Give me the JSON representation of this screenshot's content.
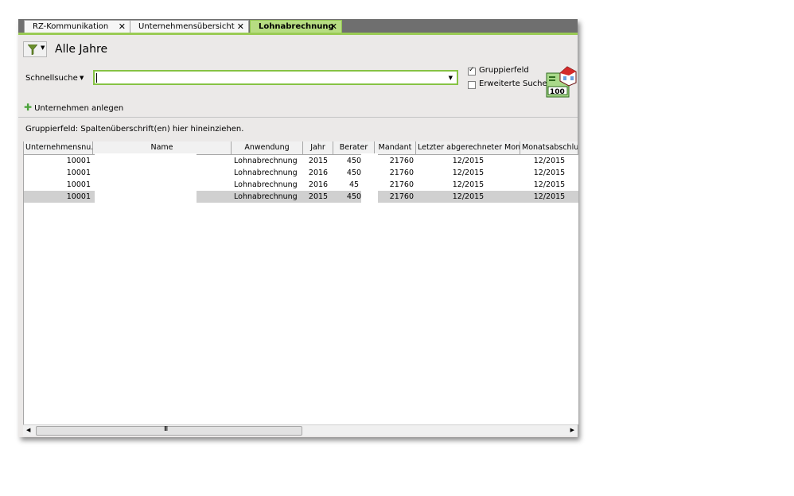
{
  "tabs": [
    {
      "label": "RZ-Kommunikation",
      "active": false
    },
    {
      "label": "Unternehmensübersicht",
      "active": false
    },
    {
      "label": "Lohnabrechnung",
      "active": true
    }
  ],
  "tab_close_glyph": "✕",
  "colors": {
    "accent": "#9acb55",
    "tab_active": "#b7dd82",
    "input_border": "#86c244",
    "selected_row": "#d0d0d0"
  },
  "header": {
    "view_title": "Alle Jahre",
    "filter_icon": "funnel-icon"
  },
  "search": {
    "label": "Schnellsuche",
    "value": ""
  },
  "options": {
    "gruppierfeld": {
      "label": "Gruppierfeld",
      "checked": true
    },
    "erweiterte_suche": {
      "label": "Erweiterte Suche",
      "checked": false
    }
  },
  "actions": {
    "add_company": "Unternehmen anlegen"
  },
  "group_hint": "Gruppierfeld: Spaltenüberschrift(en) hier hineinziehen.",
  "grid": {
    "columns": [
      "Unternehmensnu...",
      "Name",
      "Anwendung",
      "Jahr",
      "Berater",
      "Mandant",
      "Letzter abgerechneter Monat",
      "Monatsabschluss"
    ],
    "rows": [
      [
        "10001",
        "",
        "Lohnabrechnung",
        "2015",
        "450",
        "21760",
        "12/2015",
        "12/2015"
      ],
      [
        "10001",
        "",
        "Lohnabrechnung",
        "2016",
        "450",
        "21760",
        "12/2015",
        "12/2015"
      ],
      [
        "10001",
        "",
        "Lohnabrechnung",
        "2016",
        "45",
        "21760",
        "12/2015",
        "12/2015"
      ],
      [
        "10001",
        "",
        "Lohnabrechnung",
        "2015",
        "450",
        "21760",
        "12/2015",
        "12/2015"
      ]
    ],
    "selected_row": 3
  },
  "scrollbar": {
    "grip": "III"
  }
}
